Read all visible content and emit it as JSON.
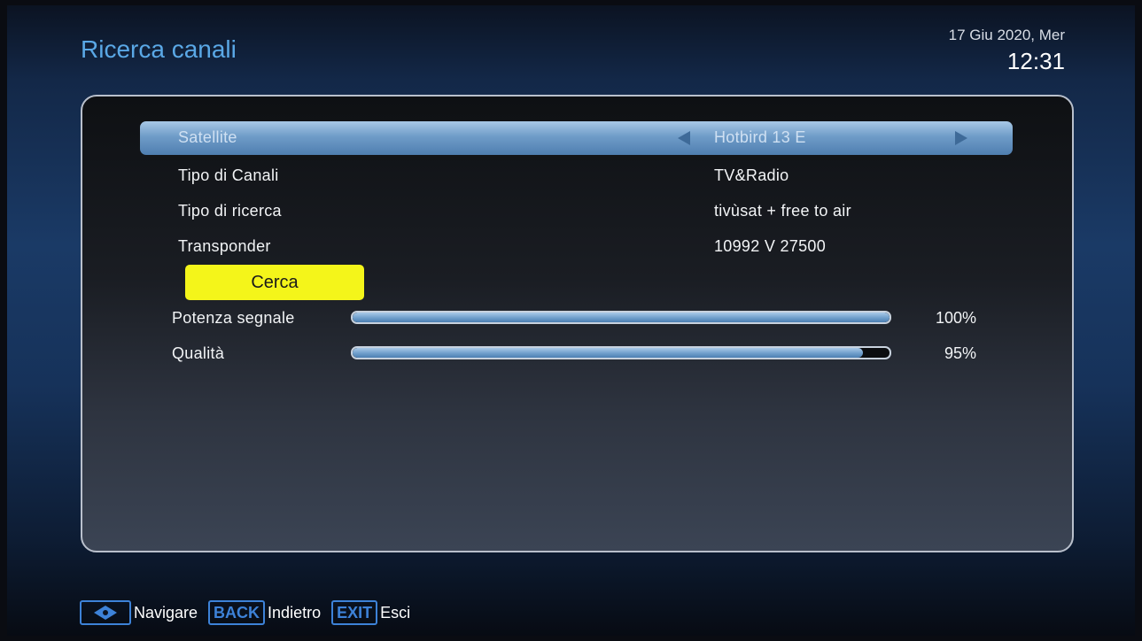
{
  "header": {
    "title": "Ricerca canali",
    "date": "17 Giu 2020, Mer",
    "time": "12:31"
  },
  "settings": [
    {
      "label": "Satellite",
      "value": "Hotbird 13 E",
      "selected": true
    },
    {
      "label": "Tipo di Canali",
      "value": "TV&Radio"
    },
    {
      "label": "Tipo di ricerca",
      "value": "tivùsat + free to air"
    },
    {
      "label": "Transponder",
      "value": "10992 V 27500"
    }
  ],
  "actions": {
    "search_label": "Cerca"
  },
  "meters": {
    "signal": {
      "label": "Potenza segnale",
      "value_text": "100%",
      "percent": 100
    },
    "quality": {
      "label": "Qualità",
      "value_text": "95%",
      "percent": 95
    }
  },
  "footer": {
    "nav_icon": "dpad-icon",
    "nav_label": "Navigare",
    "back_key": "BACK",
    "back_label": "Indietro",
    "exit_key": "EXIT",
    "exit_label": "Esci"
  },
  "colors": {
    "title": "#5aa8e6",
    "selection": "#6f9cc8",
    "button": "#f4f51a",
    "key_border": "#3d82d8"
  }
}
